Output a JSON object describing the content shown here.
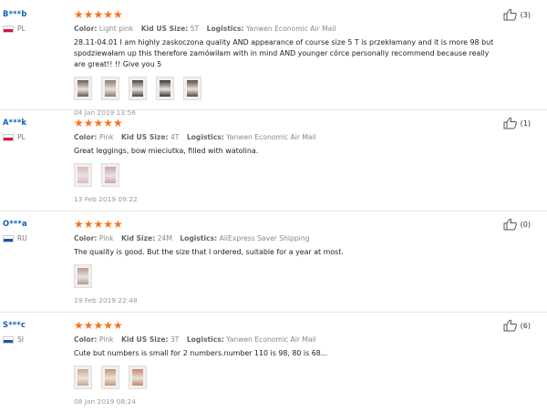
{
  "reviews": [
    {
      "user": "B***b",
      "country": "PL",
      "flag": [
        "#ffffff",
        "#dc143c"
      ],
      "stars": "★★★★★",
      "color_label": "Color:",
      "color": "Light pink",
      "size_label": "Kid US Size:",
      "size": "5T",
      "logistics_label": "Logistics:",
      "logistics": "Yanwen Economic Air Mail",
      "text": "28.11-04.01 I am highly zaskoczona quality AND appearance of course size 5 T is przekłamany and it is more 98 but spodziewałam up this therefore zamówiłam with in mind AND younger córce personally recommend because really are great!! !! Give you 5",
      "thumbs": [
        "#6b5a52",
        "#8a7a70",
        "#4a4340",
        "#3b3634",
        "#5a4c46"
      ],
      "date": "04 Jan 2019 13:56",
      "helpful": "(3)"
    },
    {
      "user": "A***k",
      "country": "PL",
      "flag": [
        "#ffffff",
        "#dc143c"
      ],
      "stars": "★★★★★",
      "color_label": "Color:",
      "color": "Pink",
      "size_label": "Kid US Size:",
      "size": "4T",
      "logistics_label": "Logistics:",
      "logistics": "Yanwen Economic Air Mail",
      "text": "Great leggings, bow mieciutka, filled with watolina.",
      "thumbs": [
        "#d9b8be",
        "#c9a2ab"
      ],
      "date": "13 Feb 2019 09:22",
      "helpful": "(1)"
    },
    {
      "user": "O***a",
      "country": "RU",
      "flag": [
        "#ffffff",
        "#1c57a5"
      ],
      "stars": "★★★★★",
      "color_label": "Color:",
      "color": "Pink",
      "size_label": "Kid Size:",
      "size": "24M",
      "logistics_label": "Logistics:",
      "logistics": "AliExpress Saver Shipping",
      "text": "The quality is good. But the size that I ordered, suitable for a year at most.",
      "thumbs": [
        "#b49a94"
      ],
      "date": "19 Feb 2019 22:48",
      "helpful": "(0)"
    },
    {
      "user": "S***c",
      "country": "SI",
      "flag": [
        "#ffffff",
        "#1c57a5"
      ],
      "stars": "★★★★★",
      "color_label": "Color:",
      "color": "Pink",
      "size_label": "Kid US Size:",
      "size": "3T",
      "logistics_label": "Logistics:",
      "logistics": "Yanwen Economic Air Mail",
      "text": "Cute but numbers is small for 2 numbers.number 110 is 98, 80 is 68...",
      "thumbs": [
        "#c8a890",
        "#c49470",
        "#c7866c"
      ],
      "date": "08 Jan 2019 08:24",
      "helpful": "(6)"
    }
  ]
}
